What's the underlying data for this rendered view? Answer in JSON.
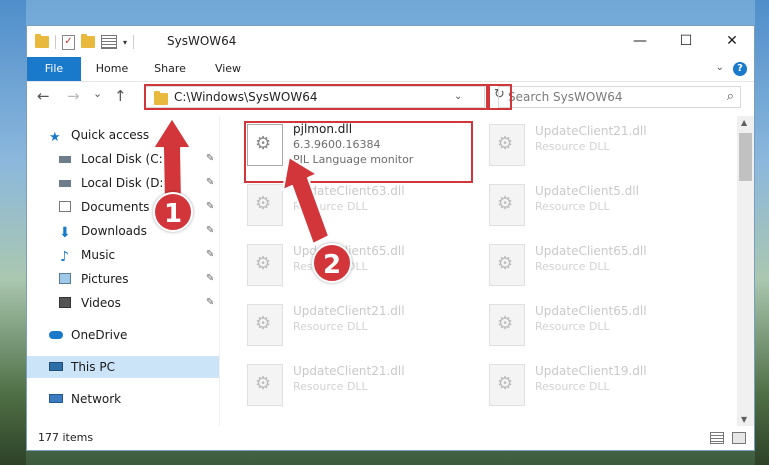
{
  "window": {
    "title": "SysWOW64",
    "minimize": "—",
    "maximize": "☐",
    "close": "✕"
  },
  "ribbon": {
    "tabs": [
      {
        "label": "File"
      },
      {
        "label": "Home"
      },
      {
        "label": "Share"
      },
      {
        "label": "View"
      }
    ],
    "help": "?"
  },
  "nav": {
    "back": "←",
    "forward": "→",
    "recent": "⌄",
    "up": "↑",
    "address": "C:\\Windows\\SysWOW64",
    "search_placeholder": "Search SysWOW64"
  },
  "sidebar": {
    "items": [
      {
        "label": "Quick access",
        "icon": "star-icon"
      },
      {
        "label": "Local Disk (C:)",
        "icon": "drive-icon",
        "pinned": true
      },
      {
        "label": "Local Disk (D:)",
        "icon": "drive-icon",
        "pinned": true
      },
      {
        "label": "Documents",
        "icon": "documents-icon",
        "pinned": true
      },
      {
        "label": "Downloads",
        "icon": "downloads-icon",
        "pinned": true
      },
      {
        "label": "Music",
        "icon": "music-icon",
        "pinned": true
      },
      {
        "label": "Pictures",
        "icon": "pictures-icon",
        "pinned": true
      },
      {
        "label": "Videos",
        "icon": "videos-icon",
        "pinned": true
      },
      {
        "label": "OneDrive",
        "icon": "cloud-icon"
      },
      {
        "label": "This PC",
        "icon": "computer-icon",
        "selected": true
      },
      {
        "label": "Network",
        "icon": "network-icon"
      }
    ]
  },
  "files": {
    "main": {
      "name": "pjlmon.dll",
      "version": "6.3.9600.16384",
      "type": "PJL Language monitor"
    },
    "faded": [
      {
        "name": "UpdateClient21.dll",
        "type": "Resource DLL"
      },
      {
        "name": "UpdateClient63.dll",
        "type": "Resource DLL"
      },
      {
        "name": "UpdateClient5.dll",
        "type": "Resource DLL"
      },
      {
        "name": "UpdateClient65.dll",
        "type": "Resource DLL"
      },
      {
        "name": "UpdateClient65.dll",
        "type": "Resource DLL"
      },
      {
        "name": "UpdateClient21.dll",
        "type": "Resource DLL"
      },
      {
        "name": "UpdateClient65.dll",
        "type": "Resource DLL"
      },
      {
        "name": "UpdateClient21.dll",
        "type": "Resource DLL"
      },
      {
        "name": "UpdateClient19.dll",
        "type": "Resource DLL"
      }
    ]
  },
  "status": {
    "items": "177 items"
  },
  "annotations": {
    "step1": "1",
    "step2": "2",
    "color": "#d3363a"
  }
}
